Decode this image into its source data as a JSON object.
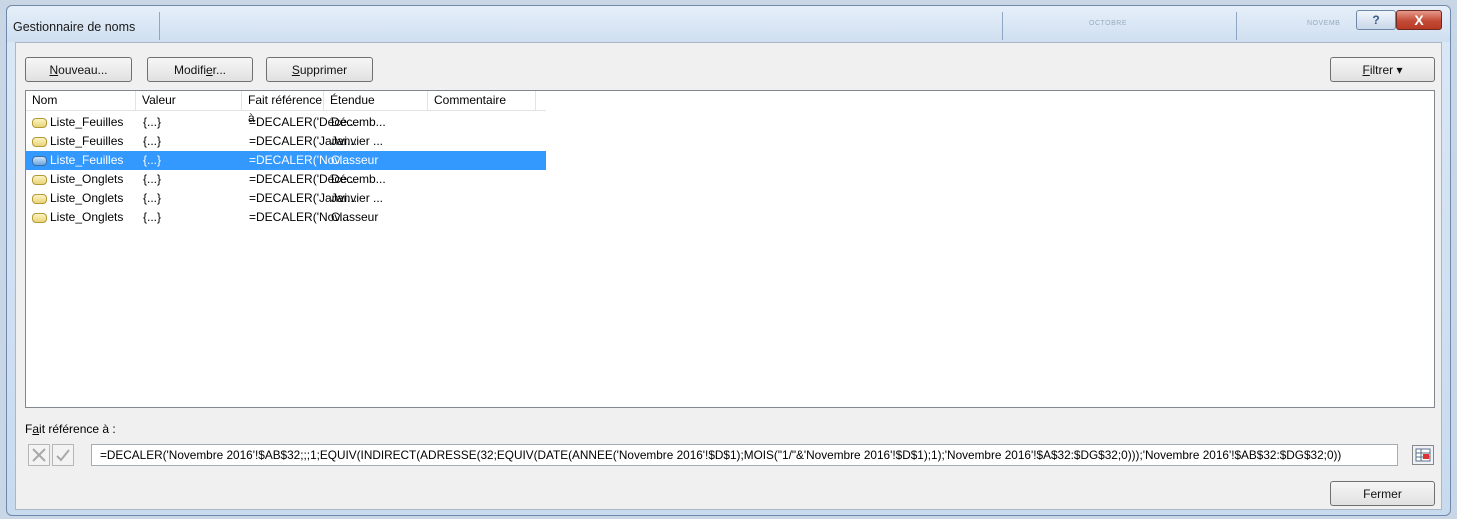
{
  "window": {
    "title": "Gestionnaire de noms",
    "background_ghost_labels": [
      "OCTOBRE",
      "NOVEMB"
    ],
    "help_button": "?",
    "close_button": "X"
  },
  "toolbar": {
    "new": {
      "label": "Nouveau...",
      "mnemonic": "N",
      "rest": "ouveau..."
    },
    "edit": {
      "label": "Modifier...",
      "pre": "Modifi",
      "mnemonic": "e",
      "post": "r..."
    },
    "delete": {
      "label": "Supprimer",
      "mnemonic": "S",
      "rest": "upprimer"
    },
    "filter": {
      "label": "Filtrer",
      "mnemonic": "F",
      "rest": "iltrer",
      "arrow": "▾"
    }
  },
  "names_list": {
    "columns": [
      "Nom",
      "Valeur",
      "Fait référence à",
      "Étendue",
      "Commentaire"
    ],
    "selected_index": 2,
    "rows": [
      {
        "name": "Liste_Feuilles",
        "value": "{...}",
        "refers_to": "=DECALER('Déce...",
        "scope": "Décemb...",
        "comment": ""
      },
      {
        "name": "Liste_Feuilles",
        "value": "{...}",
        "refers_to": "=DECALER('Janvi...",
        "scope": "Janvier ...",
        "comment": ""
      },
      {
        "name": "Liste_Feuilles",
        "value": "{...}",
        "refers_to": "=DECALER('Nov...",
        "scope": "Classeur",
        "comment": ""
      },
      {
        "name": "Liste_Onglets",
        "value": "{...}",
        "refers_to": "=DECALER('Déce...",
        "scope": "Décemb...",
        "comment": ""
      },
      {
        "name": "Liste_Onglets",
        "value": "{...}",
        "refers_to": "=DECALER('Janvi...",
        "scope": "Janvier ...",
        "comment": ""
      },
      {
        "name": "Liste_Onglets",
        "value": "{...}",
        "refers_to": "=DECALER('Nov...",
        "scope": "Classeur",
        "comment": ""
      }
    ]
  },
  "refers_to_section": {
    "label": "Fait référence à :",
    "label_mnemonic": "a",
    "label_pre": "F",
    "label_post": "it référence à :",
    "formula": "=DECALER('Novembre 2016'!$AB$32;;;1;EQUIV(INDIRECT(ADRESSE(32;EQUIV(DATE(ANNEE('Novembre 2016'!$D$1);MOIS(\"1/\"&'Novembre 2016'!$D$1);1);'Novembre 2016'!$A$32:$DG$32;0)));'Novembre 2016'!$AB$32:$DG$32;0))",
    "cancel_icon": "x-icon",
    "confirm_icon": "check-icon"
  },
  "footer": {
    "close_label": "Fermer"
  },
  "colors": {
    "selection": "#3399ff",
    "frame": "#c8daee",
    "close_red": "#c24b36"
  }
}
